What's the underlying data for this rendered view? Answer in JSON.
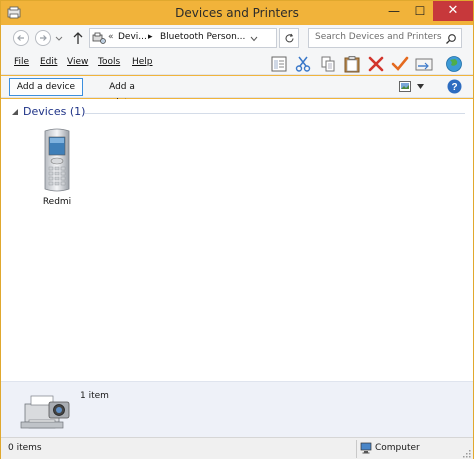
{
  "window": {
    "title": "Devices and Printers",
    "minimize_glyph": "—",
    "maximize_glyph": "☐",
    "close_glyph": "✕",
    "accent_color": "#f1b33a",
    "close_color": "#c7383b"
  },
  "address": {
    "separator": "«",
    "crumbs": [
      "Devi...",
      "Bluetooth Person..."
    ],
    "crumb_arrow": "▸",
    "icon": "devices-folder-icon"
  },
  "search": {
    "placeholder": "Search Devices and Printers"
  },
  "menu": {
    "items": [
      {
        "label": "File",
        "key": "F"
      },
      {
        "label": "Edit",
        "key": "E"
      },
      {
        "label": "View",
        "key": "V"
      },
      {
        "label": "Tools",
        "key": "T"
      },
      {
        "label": "Help",
        "key": "H"
      }
    ],
    "toolbar_icons": [
      "properties-icon",
      "cut-icon",
      "copy-icon",
      "paste-icon",
      "delete-icon",
      "checkmark-icon",
      "email-icon",
      "globe-icon"
    ]
  },
  "commands": {
    "add_device": "Add a device",
    "add_printer": "Add a printer"
  },
  "content": {
    "group_header": "Devices (1)",
    "devices": [
      {
        "label": "Redmi",
        "icon": "mobile-phone-icon"
      }
    ]
  },
  "details": {
    "text": "1 item",
    "icon": "printer-camera-icon"
  },
  "status": {
    "left": "0 items",
    "right": "Computer"
  }
}
